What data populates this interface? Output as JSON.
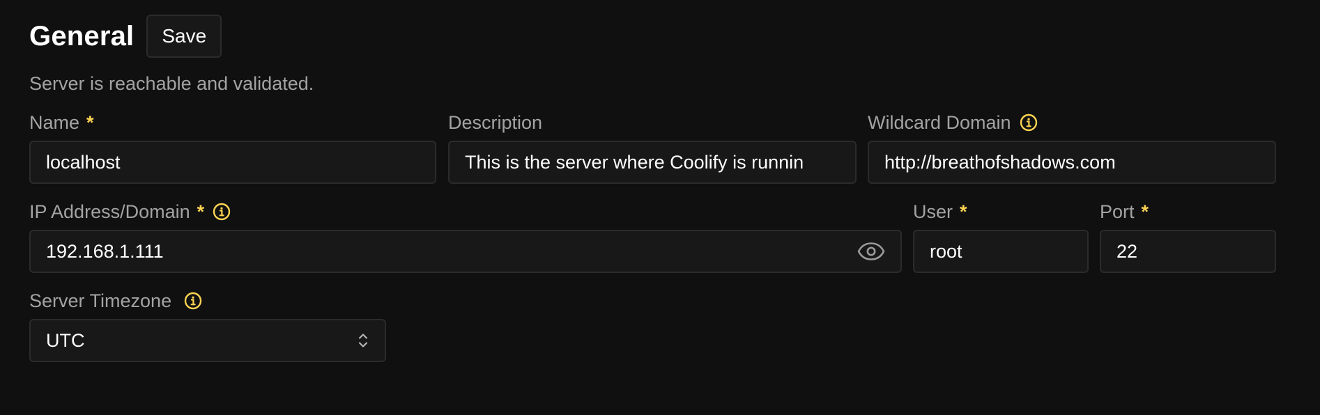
{
  "header": {
    "title": "General",
    "save_label": "Save",
    "status_text": "Server is reachable and validated."
  },
  "fields": {
    "name": {
      "label": "Name",
      "required_mark": "*",
      "value": "localhost"
    },
    "description": {
      "label": "Description",
      "value": "This is the server where Coolify is runnin"
    },
    "wildcard_domain": {
      "label": "Wildcard Domain",
      "value": "http://breathofshadows.com",
      "icon": "info-icon"
    },
    "ip_address": {
      "label": "IP Address/Domain",
      "required_mark": "*",
      "value": "192.168.1.111",
      "icon": "info-icon",
      "toggle_icon": "eye-icon"
    },
    "user": {
      "label": "User",
      "required_mark": "*",
      "value": "root"
    },
    "port": {
      "label": "Port",
      "required_mark": "*",
      "value": "22"
    },
    "timezone": {
      "label": "Server Timezone",
      "value": "UTC",
      "icon": "info-icon",
      "select_icon": "chevron-up-down-icon"
    }
  },
  "colors": {
    "background": "#101010",
    "input_background": "#181818",
    "border": "#2b2b2b",
    "accent": "#fcd452",
    "muted_text": "#a3a3a3"
  }
}
